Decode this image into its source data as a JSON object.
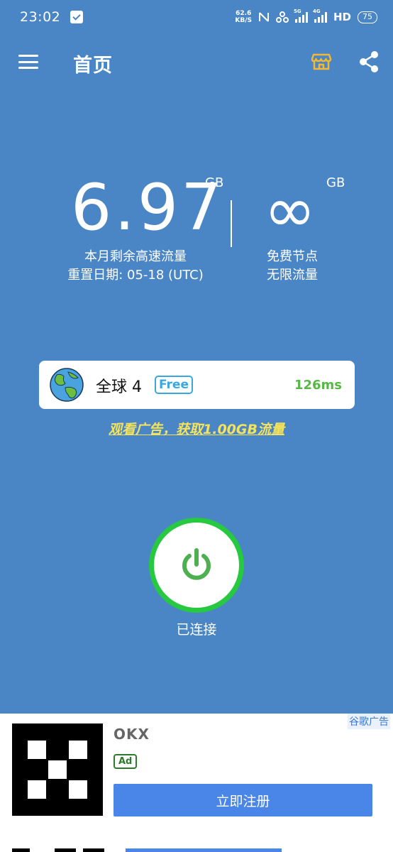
{
  "status_bar": {
    "time": "23:02",
    "net_speed_value": "62.6",
    "net_speed_unit": "KB/S",
    "sig1_label": "5G",
    "sig2_label": "4G",
    "hd_label": "HD",
    "battery": "75"
  },
  "app_bar": {
    "title": "首页",
    "menu_icon": "menu-icon",
    "store_icon": "store-icon",
    "share_icon": "share-icon",
    "accent_color": "#f2b830"
  },
  "stats": {
    "remaining_value": "6.97",
    "remaining_unit": "GB",
    "remaining_label": "本月剩余高速流量",
    "reset_label": "重置日期: 05-18 (UTC)",
    "free_value": "∞",
    "free_unit": "GB",
    "free_label": "免费节点",
    "free_sublabel": "无限流量"
  },
  "server": {
    "name": "全球 4",
    "badge": "Free",
    "latency": "126ms",
    "icon": "globe-icon"
  },
  "reward_link": "观看广告，获取1.00GB流量",
  "connection": {
    "status": "已连接",
    "icon": "power-icon",
    "ring_color": "#26c93f"
  },
  "ad": {
    "source": "谷歌广告",
    "brand": "OKX",
    "badge": "Ad",
    "cta": "立即注册"
  },
  "colors": {
    "background": "#4a86c5",
    "latency": "#57b846",
    "reward_link": "#f5e35a"
  }
}
